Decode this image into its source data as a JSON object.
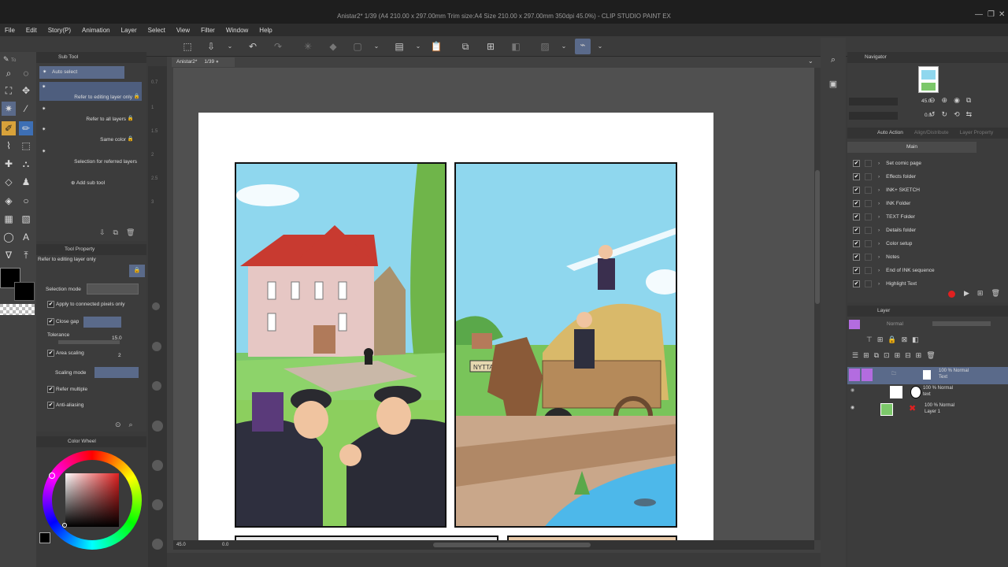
{
  "window": {
    "title": "Anistar2* 1/39 (A4 210.00 x 297.00mm Trim size:A4 Size 210.00 x 297.00mm 350dpi 45.0%) - CLIP STUDIO PAINT EX"
  },
  "menu": [
    "File",
    "Edit",
    "Story(P)",
    "Animation",
    "Layer",
    "Select",
    "View",
    "Filter",
    "Window",
    "Help"
  ],
  "canvas_tab": {
    "name": "Anistar2*",
    "page": "1/39"
  },
  "subtool": {
    "header": "Sub Tool",
    "tab_short": "To",
    "items": [
      "Auto select",
      "Refer to editing layer only",
      "Refer to all layers",
      "Same color",
      "Selection for referred layers"
    ],
    "add_label": "Add sub tool"
  },
  "toolprop": {
    "header": "Tool Property",
    "current": "Refer to editing layer only",
    "selection_mode": "Selection mode",
    "apply_connected": "Apply to connected pixels only",
    "close_gap": "Close gap",
    "tolerance_label": "Tolerance",
    "tolerance_value": "15.0",
    "area_scaling": "Area scaling",
    "area_value": "2",
    "scaling_mode": "Scaling mode",
    "refer_multiple": "Refer multiple",
    "anti_aliasing": "Anti-aliasing"
  },
  "colorwheel": {
    "header": "Color Wheel"
  },
  "ruler_ticks": [
    "0.7",
    "1",
    "1.5",
    "2",
    "2.5",
    "3"
  ],
  "status": {
    "zoom": "45.0",
    "angle": "0.0"
  },
  "navigator": {
    "header": "Navigator",
    "zoom": "45.0",
    "rotation": "0.0"
  },
  "autoaction": {
    "tabs": [
      "Auto Action",
      "Align/Distribute",
      "Layer Property"
    ],
    "set": "Main",
    "items": [
      "Set comic page",
      "Effects folder",
      "INK+ SKETCH",
      "INK Folder",
      "TEXT Folder",
      "Details folder",
      "Color setup",
      "Notes",
      "End of INK sequence",
      "Highlight Text"
    ]
  },
  "layers": {
    "header": "Layer",
    "blend": "Normal",
    "rows": [
      {
        "mode": "100 % Normal",
        "name": "Text"
      },
      {
        "mode": "100 % Normal",
        "name": "text"
      },
      {
        "mode": "100 % Normal",
        "name": "Layer 1"
      }
    ]
  },
  "comic": {
    "sign": "NYTTA"
  },
  "colors": {
    "accent": "#b36ce0",
    "highlight": "#5a6a8a",
    "record": "#e02020"
  }
}
